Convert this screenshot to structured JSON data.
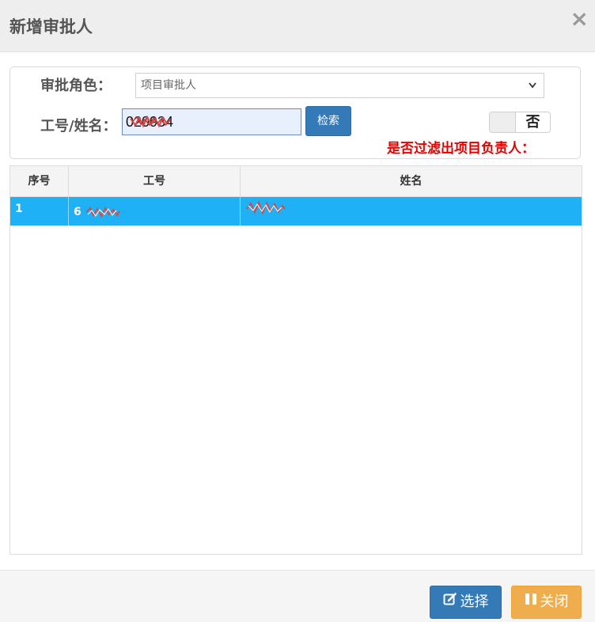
{
  "dialog": {
    "title": "新增审批人",
    "close_glyph": "×"
  },
  "filters": {
    "role_label": "审批角色：",
    "role_value": "项目审批人",
    "id_label": "工号/姓名：",
    "id_value": "020934",
    "search_label": "检索",
    "toggle_text": "否",
    "filter_note": "是否过滤出项目负责人："
  },
  "table": {
    "headers": [
      "序号",
      "工号",
      "姓名"
    ],
    "rows": [
      {
        "index": "1",
        "employee_no": "6",
        "name": ""
      }
    ]
  },
  "footer": {
    "select_label": "选择",
    "close_label": "关闭"
  },
  "colors": {
    "primary": "#337ab7",
    "warning": "#f0ad4e",
    "selected_row": "#1fb1f6",
    "note_red": "#e60000"
  },
  "icons": {
    "select": "edit-icon",
    "close": "pause-icon"
  }
}
